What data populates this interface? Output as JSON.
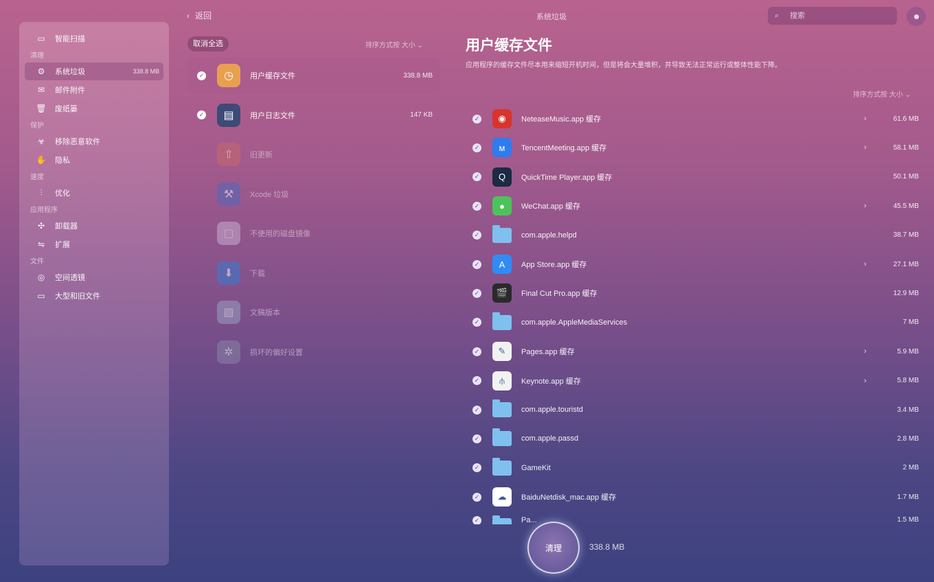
{
  "sidebar": {
    "top_item": {
      "label": "智能扫描",
      "icon": "monitor-icon"
    },
    "sections": [
      {
        "title": "清理",
        "items": [
          {
            "label": "系统垃圾",
            "icon": "gear-icon",
            "size": "338.8 MB",
            "active": true
          },
          {
            "label": "邮件附件",
            "icon": "mail-icon"
          },
          {
            "label": "废纸篓",
            "icon": "trash-icon"
          }
        ]
      },
      {
        "title": "保护",
        "items": [
          {
            "label": "移除恶意软件",
            "icon": "biohazard-icon"
          },
          {
            "label": "隐私",
            "icon": "hand-icon"
          }
        ]
      },
      {
        "title": "速度",
        "items": [
          {
            "label": "优化",
            "icon": "sliders-icon"
          }
        ]
      },
      {
        "title": "应用程序",
        "items": [
          {
            "label": "卸载器",
            "icon": "uninstall-icon"
          },
          {
            "label": "扩展",
            "icon": "extension-icon"
          }
        ]
      },
      {
        "title": "文件",
        "items": [
          {
            "label": "空间透镜",
            "icon": "lens-icon"
          },
          {
            "label": "大型和旧文件",
            "icon": "folder-icon"
          }
        ]
      }
    ]
  },
  "topbar": {
    "back_label": "返回",
    "title": "系统垃圾",
    "search_placeholder": "搜索"
  },
  "middle": {
    "deselect_label": "取消全选",
    "sort_label": "排序方式按 大小 ⌄",
    "categories": [
      {
        "label": "用户缓存文件",
        "size": "338.8 MB",
        "checked": true,
        "selected": true,
        "icon": "cache-icon",
        "dim": false
      },
      {
        "label": "用户日志文件",
        "size": "147 KB",
        "checked": true,
        "selected": false,
        "icon": "log-icon",
        "dim": false
      },
      {
        "label": "旧更新",
        "size": "",
        "checked": false,
        "selected": false,
        "icon": "update-icon",
        "dim": true
      },
      {
        "label": "Xcode 垃圾",
        "size": "",
        "checked": false,
        "selected": false,
        "icon": "xcode-icon",
        "dim": true
      },
      {
        "label": "不使用的磁盘镜像",
        "size": "",
        "checked": false,
        "selected": false,
        "icon": "disk-image-icon",
        "dim": true
      },
      {
        "label": "下载",
        "size": "",
        "checked": false,
        "selected": false,
        "icon": "download-icon",
        "dim": true
      },
      {
        "label": "文稿版本",
        "size": "",
        "checked": false,
        "selected": false,
        "icon": "document-icon",
        "dim": true
      },
      {
        "label": "损坏的偏好设置",
        "size": "",
        "checked": false,
        "selected": false,
        "icon": "broken-gear-icon",
        "dim": true
      }
    ]
  },
  "right": {
    "title": "用户缓存文件",
    "description": "应用程序的缓存文件尽本用来缩短开机时间，但是将会大量堆积，并导致无法正常运行或整体性能下降。",
    "sort_label": "排序方式按 大小 ⌄",
    "files": [
      {
        "name": "NeteaseMusic.app 缓存",
        "size": "61.6 MB",
        "has_arrow": true,
        "icon": "netease-icon",
        "color": "#d8342e"
      },
      {
        "name": "TencentMeeting.app 缓存",
        "size": "58.1 MB",
        "has_arrow": true,
        "icon": "meeting-icon",
        "color": "#2d7cf0"
      },
      {
        "name": "QuickTime Player.app 缓存",
        "size": "50.1 MB",
        "has_arrow": false,
        "icon": "quicktime-icon",
        "color": "#1c2a44"
      },
      {
        "name": "WeChat.app 缓存",
        "size": "45.5 MB",
        "has_arrow": true,
        "icon": "wechat-icon",
        "color": "#4cc35a"
      },
      {
        "name": "com.apple.helpd",
        "size": "38.7 MB",
        "has_arrow": false,
        "icon": "folder-icon",
        "color": "#7fc0ee"
      },
      {
        "name": "App Store.app 缓存",
        "size": "27.1 MB",
        "has_arrow": true,
        "icon": "appstore-icon",
        "color": "#2f8cf5"
      },
      {
        "name": "Final Cut Pro.app 缓存",
        "size": "12.9 MB",
        "has_arrow": false,
        "icon": "finalcut-icon",
        "color": "#2a2a2a"
      },
      {
        "name": "com.apple.AppleMediaServices",
        "size": "7 MB",
        "has_arrow": false,
        "icon": "folder-icon",
        "color": "#7fc0ee"
      },
      {
        "name": "Pages.app 缓存",
        "size": "5.9 MB",
        "has_arrow": true,
        "icon": "pages-icon",
        "color": "#f2f2f2"
      },
      {
        "name": "Keynote.app 缓存",
        "size": "5.8 MB",
        "has_arrow": true,
        "icon": "keynote-icon",
        "color": "#f2f2f2"
      },
      {
        "name": "com.apple.touristd",
        "size": "3.4 MB",
        "has_arrow": false,
        "icon": "folder-icon",
        "color": "#7fc0ee"
      },
      {
        "name": "com.apple.passd",
        "size": "2.8 MB",
        "has_arrow": false,
        "icon": "folder-icon",
        "color": "#7fc0ee"
      },
      {
        "name": "GameKit",
        "size": "2 MB",
        "has_arrow": false,
        "icon": "folder-icon",
        "color": "#7fc0ee"
      },
      {
        "name": "BaiduNetdisk_mac.app 缓存",
        "size": "1.7 MB",
        "has_arrow": false,
        "icon": "baidu-icon",
        "color": "#ffffff"
      },
      {
        "name": "Pa...",
        "size": "1.5 MB",
        "has_arrow": false,
        "icon": "folder-icon",
        "color": "#7fc0ee"
      }
    ]
  },
  "footer": {
    "clean_label": "清理",
    "total_size": "338.8 MB"
  }
}
